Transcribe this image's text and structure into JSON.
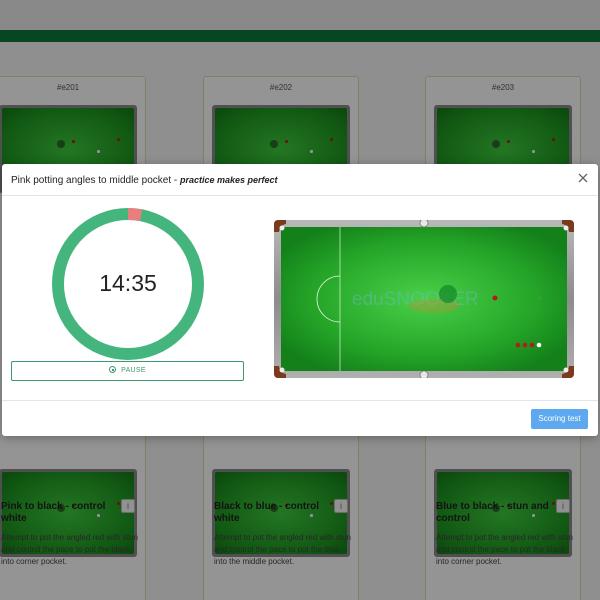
{
  "background": {
    "cards": [
      {
        "code": "#e201",
        "title": "Pink to black - control white",
        "info_label": "i",
        "description": "Attempt to pot the angled red with stun and control the pace to pot the black into corner pocket."
      },
      {
        "code": "#e202",
        "title": "Black to blue - control white",
        "info_label": "i",
        "description": "Attempt to pot the angled red with stun and control the pace to pot the blue into the middle pocket."
      },
      {
        "code": "#e203",
        "title": "Blue to black - stun and control",
        "info_label": "i",
        "description": "Attempt to pot the angled red with stun and control the pace to pot the black into corner pocket."
      }
    ]
  },
  "modal": {
    "title": "Pink potting angles to middle pocket",
    "subtitle": "practice makes perfect",
    "separator": " - ",
    "close_icon": "close-icon",
    "timer": {
      "display": "14:35",
      "progress_fraction": 0.03,
      "ring_color": "#44b57d",
      "elapsed_color": "#e87f7f"
    },
    "pause_label": "PAUSE",
    "table_watermark": "eduSNOOKER",
    "scoring_button_label": "Scoring test"
  },
  "colors": {
    "brand_green": "#0b7a3b",
    "felt": "#2bb02e",
    "primary_button": "#5ea8f0"
  }
}
